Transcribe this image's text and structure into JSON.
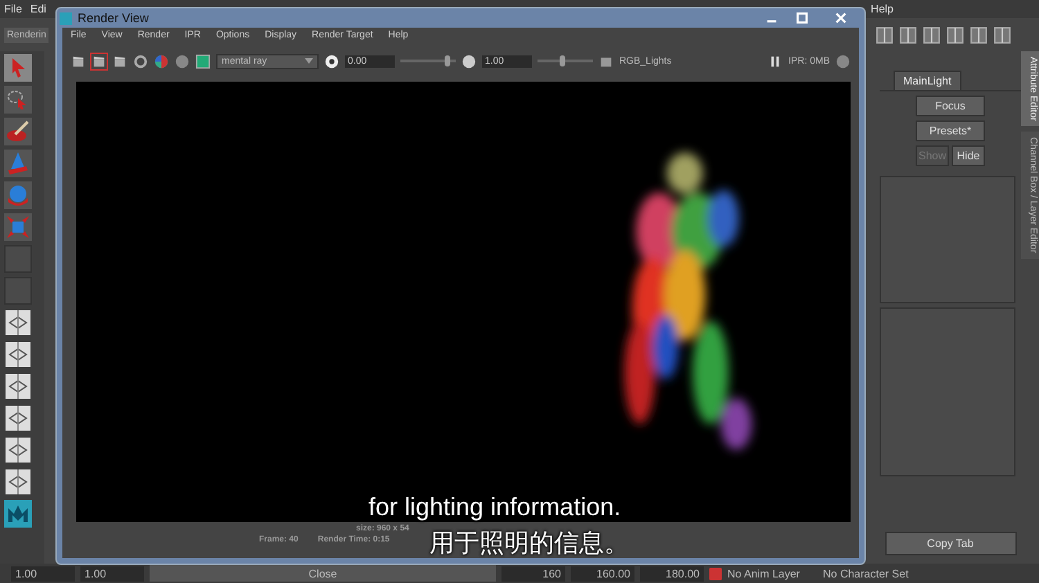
{
  "main_menu": [
    "File",
    "Edi"
  ],
  "main_menu_right": [
    "Help"
  ],
  "shelf_tab": "Renderin",
  "render_view": {
    "title": "Render View",
    "menu": [
      "File",
      "View",
      "Render",
      "IPR",
      "Options",
      "Display",
      "Render Target",
      "Help"
    ],
    "renderer": "mental ray",
    "exposure": "0.00",
    "exposure_slider": {
      "level": 0.85
    },
    "gamma": "1.00",
    "gamma_slider": {
      "level": 0.45
    },
    "layer": "RGB_Lights",
    "ipr": "IPR: 0MB",
    "size": "size: 960 x 54",
    "frame": "Frame: 40",
    "render_time": "Render Time: 0:15"
  },
  "attribute_editor": {
    "tabs": [
      {
        "label": "MainLight",
        "selected": true
      }
    ],
    "buttons": [
      {
        "label": "Focus",
        "disabled": false
      },
      {
        "label": "Presets*",
        "disabled": false
      }
    ],
    "visibility_buttons": [
      {
        "label": "Show",
        "disabled": true
      },
      {
        "label": "Hide",
        "disabled": false
      }
    ],
    "copy_tab": "Copy Tab",
    "side_tabs": [
      {
        "label": "Attribute Editor",
        "selected": true
      },
      {
        "label": "Channel Box / Layer Editor",
        "selected": false
      }
    ]
  },
  "close_button": "Close",
  "time_fields": [
    "1.00",
    "1.00"
  ],
  "range_fields": [
    "160",
    "160.00",
    "180.00"
  ],
  "anim_layer": "No Anim Layer",
  "character_set": "No Character Set",
  "captions": [
    "for lighting information.",
    "用于照明的信息。"
  ]
}
